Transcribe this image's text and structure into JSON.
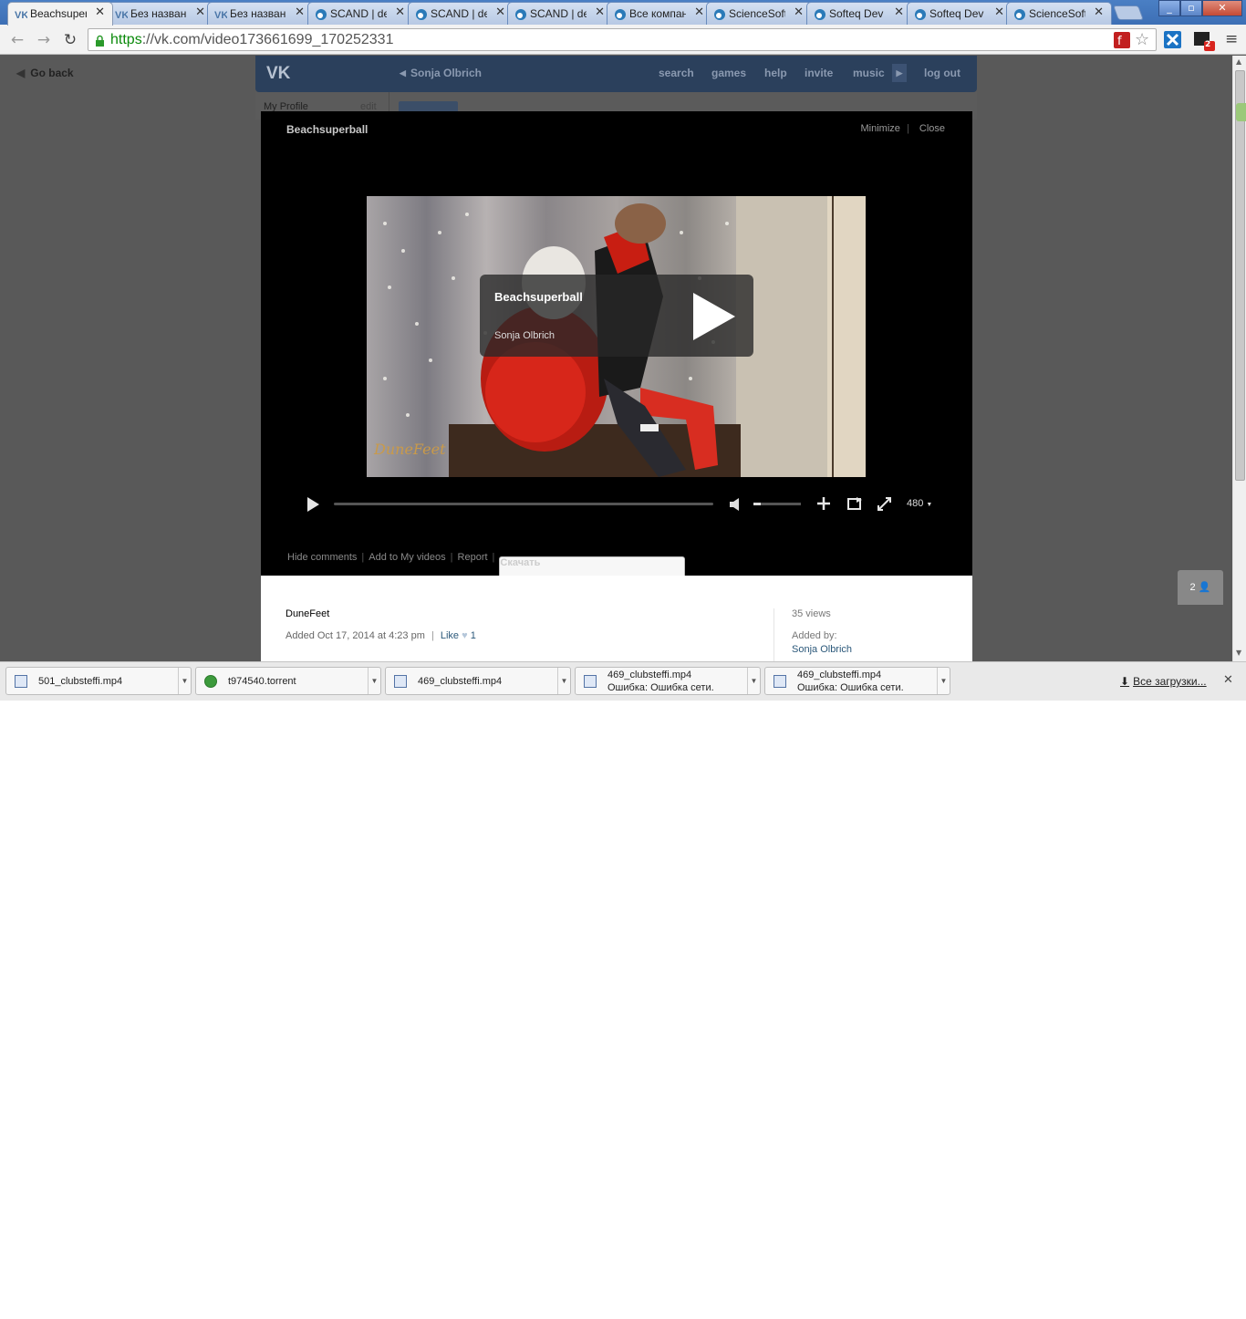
{
  "browser": {
    "tabs": [
      {
        "label": "Beachsuper",
        "icon": "vk-icon",
        "active": true
      },
      {
        "label": "Без назван",
        "icon": "vk-icon"
      },
      {
        "label": "Без назван",
        "icon": "vk-icon"
      },
      {
        "label": "SCAND | de",
        "icon": "d-icon"
      },
      {
        "label": "SCAND | de",
        "icon": "d-icon"
      },
      {
        "label": "SCAND | de",
        "icon": "d-icon"
      },
      {
        "label": "Все компан",
        "icon": "d-icon"
      },
      {
        "label": "ScienceSoft",
        "icon": "d-icon"
      },
      {
        "label": "Softeq Dev",
        "icon": "d-icon"
      },
      {
        "label": "Softeq Dev",
        "icon": "d-icon"
      },
      {
        "label": "ScienceSoft",
        "icon": "d-icon"
      }
    ],
    "url_scheme": "https",
    "url_rest": "://vk.com/video173661699_170252331",
    "ext_badge": "2"
  },
  "page": {
    "go_back": "Go back",
    "header": {
      "profile_name": "Sonja Olbrich",
      "nav": [
        "search",
        "games",
        "help",
        "invite",
        "music"
      ],
      "logout": "log out"
    },
    "side": {
      "my_profile": "My Profile",
      "edit": "edit"
    },
    "video": {
      "title": "Beachsuperball",
      "minimize": "Minimize",
      "separator": "|",
      "close": "Close",
      "overlay_title": "Beachsuperball",
      "overlay_author": "Sonja Olbrich",
      "watermark": "DuneFeet",
      "quality": "480",
      "actions": {
        "hide_comments": "Hide comments",
        "add_to_videos": "Add to My videos",
        "report": "Report",
        "download": "Скачать"
      }
    },
    "info": {
      "author": "DuneFeet",
      "added": "Added Oct 17, 2014 at 4:23 pm",
      "like": "Like",
      "like_count": "1",
      "views": "35 views",
      "added_by_label": "Added by:",
      "added_by_name": "Sonja Olbrich"
    },
    "viewers_count": "2"
  },
  "downloads": {
    "items": [
      {
        "name": "501_clubsteffi.mp4",
        "status": "",
        "type": "file"
      },
      {
        "name": "t974540.torrent",
        "status": "",
        "type": "torrent"
      },
      {
        "name": "469_clubsteffi.mp4",
        "status": "",
        "type": "file"
      },
      {
        "name": "469_clubsteffi.mp4",
        "status": "Ошибка: Ошибка сети.",
        "type": "file"
      },
      {
        "name": "469_clubsteffi.mp4",
        "status": "Ошибка: Ошибка сети.",
        "type": "file"
      }
    ],
    "all_downloads": "Все загрузки..."
  }
}
